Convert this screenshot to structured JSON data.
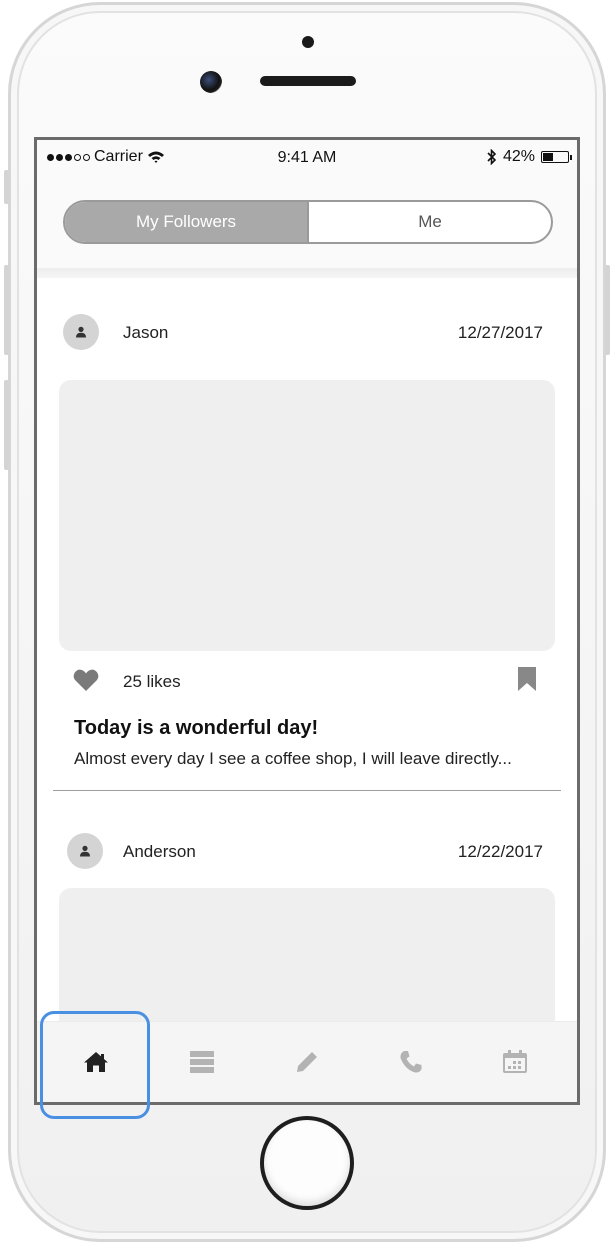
{
  "status_bar": {
    "carrier": "Carrier",
    "time": "9:41 AM",
    "battery": "42%",
    "battery_level": 0.42
  },
  "segmented_control": {
    "tabs": [
      {
        "label": "My Followers",
        "selected": true
      },
      {
        "label": "Me",
        "selected": false
      }
    ]
  },
  "posts": [
    {
      "author": "Jason",
      "date": "12/27/2017",
      "likes": "25 likes",
      "title": "Today is a wonderful day!",
      "excerpt": "Almost every day I see a coffee shop, I will leave directly..."
    },
    {
      "author": "Anderson",
      "date": "12/22/2017"
    }
  ],
  "tab_bar": {
    "items": [
      {
        "icon": "home-icon",
        "active": true
      },
      {
        "icon": "list-icon",
        "active": false
      },
      {
        "icon": "pencil-icon",
        "active": false
      },
      {
        "icon": "phone-icon",
        "active": false
      },
      {
        "icon": "calendar-icon",
        "active": false
      }
    ]
  },
  "colors": {
    "segment_active": "#a9a9a9",
    "highlight": "#4a90e2",
    "tab_active": "#222222",
    "tab_inactive": "#b3b3b3"
  }
}
